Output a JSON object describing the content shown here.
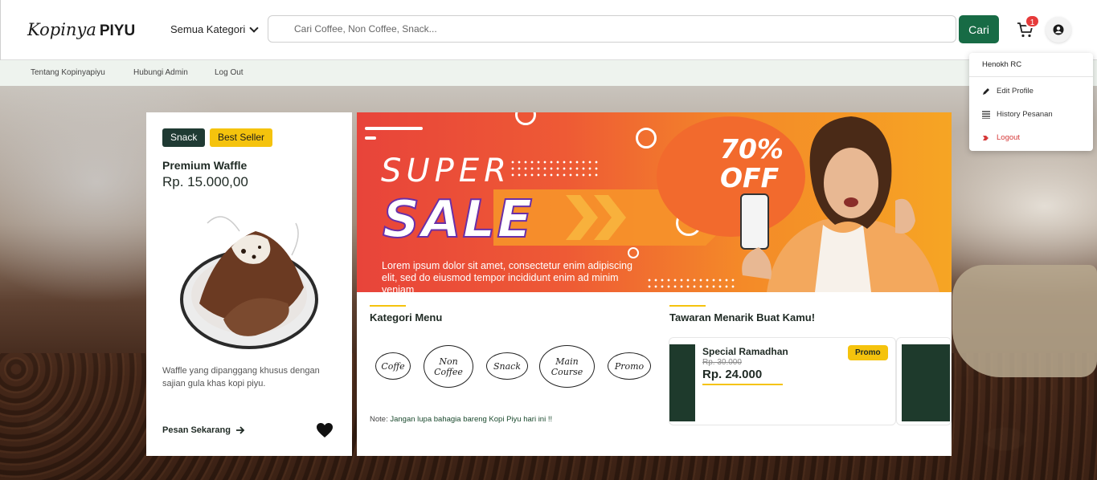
{
  "header": {
    "logo_script": "Kopinya",
    "logo_bold": "PIYU",
    "category_dropdown": "Semua Kategori",
    "search_placeholder": "Cari Coffee, Non Coffee, Snack...",
    "search_button": "Cari",
    "cart_count": "1"
  },
  "subnav": {
    "items": [
      "Tentang Kopinyapiyu",
      "Hubungi Admin",
      "Log Out"
    ]
  },
  "user_menu": {
    "username": "Henokh RC",
    "items": [
      "Edit Profile",
      "History Pesanan",
      "Logout"
    ]
  },
  "product": {
    "badges": [
      "Snack",
      "Best Seller"
    ],
    "name": "Premium Waffle",
    "price": "Rp. 15.000,00",
    "description": "Waffle yang dipanggang khusus dengan sajian gula khas kopi piyu.",
    "order_label": "Pesan Sekarang"
  },
  "banner": {
    "super": "SUPER",
    "sale": "SALE",
    "off_percent": "70%",
    "off_label": "OFF",
    "lorem": "Lorem ipsum dolor sit amet, consectetur enim adipiscing elit, sed do eiusmod tempor incididunt enim ad minim veniam"
  },
  "kategori": {
    "title": "Kategori Menu",
    "items": [
      "Coffe",
      "Non Coffee",
      "Snack",
      "Main Course",
      "Promo"
    ],
    "note_label": "Note:",
    "note_text": "Jangan lupa bahagia bareng Kopi Piyu hari ini !!"
  },
  "tawaran": {
    "title": "Tawaran Menarik Buat Kamu!",
    "offers": [
      {
        "name": "Special Ramadhan",
        "old_price": "Rp. 30.000",
        "new_price": "Rp. 24.000",
        "tag": "Promo"
      }
    ]
  },
  "colors": {
    "primary_green": "#176b45",
    "accent_yellow": "#f5c30d",
    "badge_dark": "#1f3a33",
    "logout_red": "#d63a3a"
  }
}
